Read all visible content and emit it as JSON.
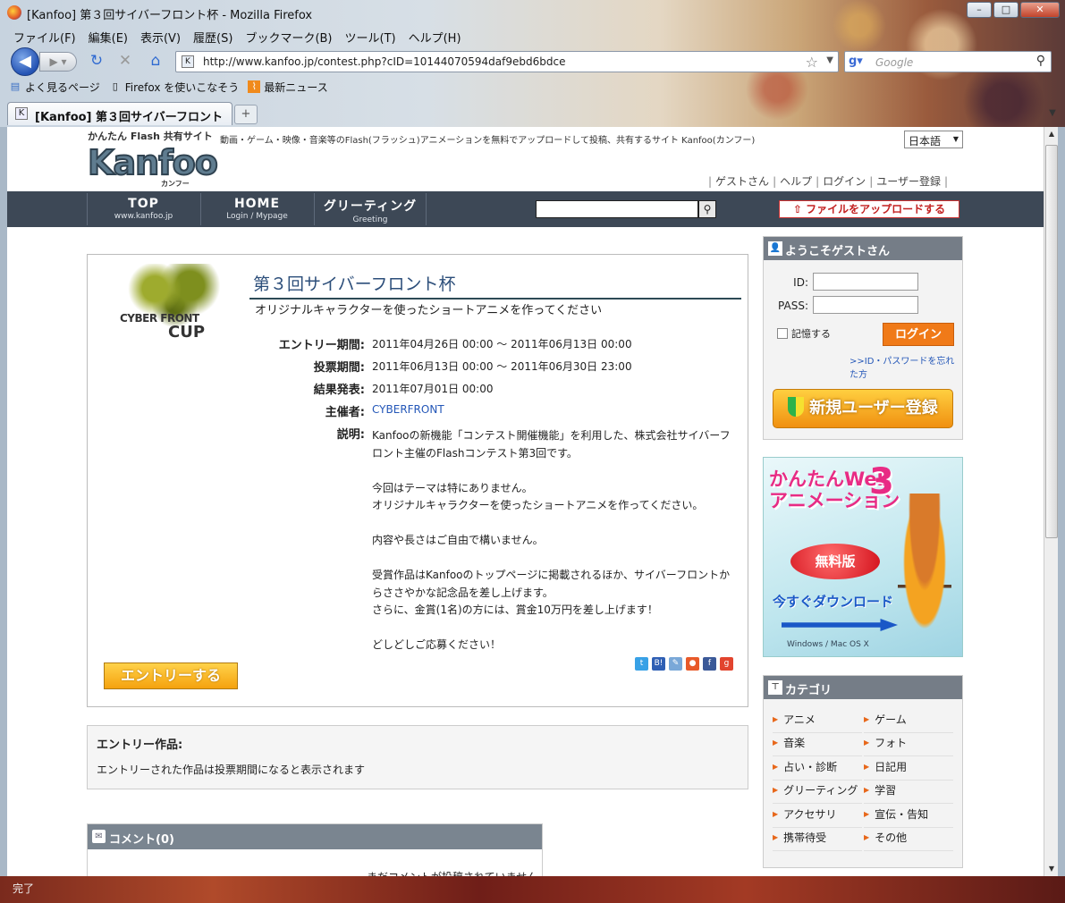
{
  "window": {
    "title": "[Kanfoo] 第３回サイバーフロント杯 - Mozilla Firefox"
  },
  "menu": [
    "ファイル(F)",
    "編集(E)",
    "表示(V)",
    "履歴(S)",
    "ブックマーク(B)",
    "ツール(T)",
    "ヘルプ(H)"
  ],
  "toolbar": {
    "url": "http://www.kanfoo.jp/contest.php?cID=10144070594daf9ebd6bdce",
    "search_placeholder": "Google"
  },
  "bookmarks": [
    "よく見るページ",
    "Firefox を使いこなそう",
    "最新ニュース"
  ],
  "tab": {
    "title": "[Kanfoo] 第３回サイバーフロント杯"
  },
  "status": "完了",
  "header": {
    "logo_tagline": "かんたん Flash 共有サイト",
    "logo_text": "Kanfoo",
    "logo_sub": "カンフー",
    "description": "動画・ゲーム・映像・音楽等のFlash(フラッシュ)アニメーションを無料でアップロードして投稿、共有するサイト Kanfoo(カンフー)",
    "language": "日本語",
    "user_links": [
      "ゲストさん",
      "ヘルプ",
      "ログイン",
      "ユーザー登録"
    ]
  },
  "gnav": {
    "items": [
      {
        "main": "TOP",
        "sub": "www.kanfoo.jp"
      },
      {
        "main": "HOME",
        "sub": "Login / Mypage"
      },
      {
        "main": "グリーティング",
        "sub": "Greeting"
      }
    ],
    "upload_label": "ファイルをアップロードする"
  },
  "contest": {
    "logo_line1": "CYBER FRONT",
    "logo_line2": "CUP",
    "title": "第３回サイバーフロント杯",
    "subtitle": "オリジナルキャラクターを使ったショートアニメを作ってください",
    "entry_period_label": "エントリー期間:",
    "entry_period": "2011年04月26日 00:00 〜 2011年06月13日 00:00",
    "vote_period_label": "投票期間:",
    "vote_period": "2011年06月13日 00:00 〜 2011年06月30日 23:00",
    "result_label": "結果発表:",
    "result_date": "2011年07月01日 00:00",
    "organizer_label": "主催者:",
    "organizer": "CYBERFRONT",
    "description_label": "説明:",
    "description": [
      "Kanfooの新機能「コンテスト開催機能」を利用した、株式会社サイバーフロント主催のFlashコンテスト第3回です。",
      "今回はテーマは特にありません。\nオリジナルキャラクターを使ったショートアニメを作ってください。",
      "内容や長さはご自由で構いません。",
      "受賞作品はKanfooのトップページに掲載されるほか、サイバーフロントからささやかな記念品を差し上げます。\nさらに、金賞(1名)の方には、賞金10万円を差し上げます！",
      "どしどしご応募ください！"
    ],
    "entry_button": "エントリーする"
  },
  "entries": {
    "title": "エントリー作品:",
    "text": "エントリーされた作品は投票期間になると表示されます"
  },
  "comments": {
    "title": "コメント(0)",
    "empty": "まだコメントが投稿されていません"
  },
  "login": {
    "title": "ようこそゲストさん",
    "id_label": "ID:",
    "pass_label": "PASS:",
    "remember_label": "記憶する",
    "login_button": "ログイン",
    "forgot_link": ">>ID・パスワードを忘れた方",
    "register_button": "新規ユーザー登録"
  },
  "ad": {
    "title_line1": "かんたんWeb",
    "title_line2": "アニメーション",
    "number": "3",
    "free_label": "無料版",
    "download_label": "今すぐダウンロード",
    "os_label": "Windows / Mac OS X"
  },
  "categories": {
    "title": "カテゴリ",
    "items": [
      "アニメ",
      "ゲーム",
      "音楽",
      "フォト",
      "占い・診断",
      "日記用",
      "グリーティング",
      "学習",
      "アクセサリ",
      "宣伝・告知",
      "携帯待受",
      "その他"
    ]
  }
}
